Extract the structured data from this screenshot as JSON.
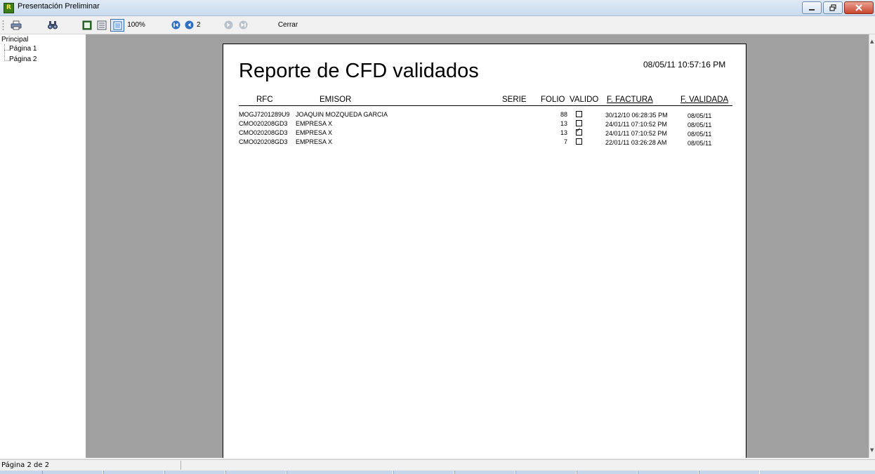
{
  "window": {
    "title": "Presentación Preliminar",
    "app_icon_letter": "R",
    "controls": [
      "minimize",
      "maximize",
      "close"
    ]
  },
  "toolbar": {
    "icons": [
      "print-icon",
      "find-icon",
      "one-page-icon",
      "multi-page-icon",
      "page-width-icon",
      "first-page-icon",
      "prev-page-icon",
      "next-page-icon",
      "last-page-icon"
    ],
    "zoom_label": "100%",
    "page_number": "2",
    "close_label": "Cerrar"
  },
  "tree": {
    "root": "Principal",
    "items": [
      {
        "label": "Página 1"
      },
      {
        "label": "Página 2"
      }
    ]
  },
  "report": {
    "title": "Reporte de CFD validados",
    "printed_at": "08/05/11 10:57:16 PM",
    "columns": {
      "rfc": "RFC",
      "emisor": "EMISOR",
      "serie": "SERIE",
      "folio": "FOLIO",
      "valido": "VALIDO",
      "f_factura": "F. FACTURA",
      "f_validada": "F. VALIDADA"
    },
    "rows": [
      {
        "rfc": "MOGJ7201289U9",
        "emisor": "JOAQUIN MOZQUEDA GARCIA",
        "serie": "",
        "folio": "88",
        "valido": false,
        "f_factura": "30/12/10 06:28:35 PM",
        "f_validada": "08/05/11"
      },
      {
        "rfc": "CMO020208GD3",
        "emisor": "EMPRESA X",
        "serie": "",
        "folio": "13",
        "valido": false,
        "f_factura": "24/01/11 07:10:52 PM",
        "f_validada": "08/05/11"
      },
      {
        "rfc": "CMO020208GD3",
        "emisor": "EMPRESA X",
        "serie": "",
        "folio": "13",
        "valido": true,
        "f_factura": "24/01/11 07:10:52 PM",
        "f_validada": "08/05/11"
      },
      {
        "rfc": "CMO020208GD3",
        "emisor": "EMPRESA X",
        "serie": "",
        "folio": "7",
        "valido": false,
        "f_factura": "22/01/11 03:26:28 AM",
        "f_validada": "08/05/11"
      }
    ]
  },
  "status": {
    "page_info": "Página 2 de 2"
  },
  "colors": {
    "preview_background": "#a0a0a0",
    "titlebar": "#c9dbee",
    "page": "#ffffff",
    "close_button": "#c8452d"
  }
}
